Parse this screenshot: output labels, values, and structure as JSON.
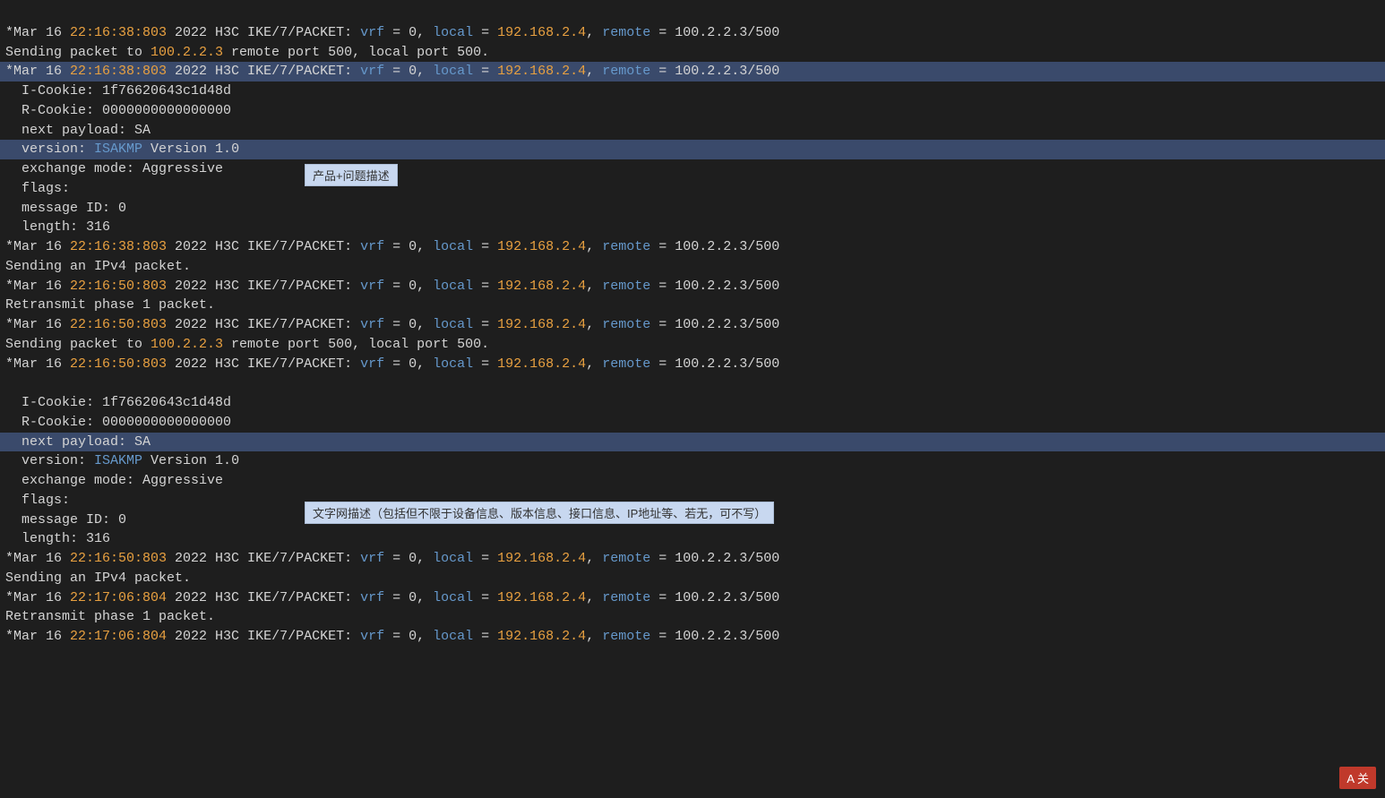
{
  "terminal": {
    "lines": [
      {
        "id": "line1",
        "type": "log",
        "prefix": "*Mar 16 ",
        "timestamp": "22:16:38:803",
        "suffix": " 2022 H3C IKE/7/PACKET: ",
        "vrf_part": "vrf",
        "rest1": " = 0, ",
        "local_label": "local",
        "rest2": " = ",
        "local_ip": "192.168.2.4",
        "rest3": ", ",
        "remote_label": "remote",
        "rest4": " = 100.2.2.3/500"
      }
    ],
    "content_blocks": [
      {
        "id": "block1",
        "lines": [
          {
            "type": "normal",
            "text": "*Mar 16 ",
            "ts": "22:16:38:803",
            "after_ts": " 2022 H3C IKE/7/PACKET: ",
            "vrf": "vrf",
            "mid": " = 0, ",
            "local_lbl": "local",
            "eq1": " = ",
            "local_ip": "192.168.2.4",
            "comma": ", ",
            "remote_lbl": "remote",
            "end": " = 100.2.2.3/500"
          },
          {
            "type": "plain",
            "text": "Sending packet to ",
            "highlight_word": "100.2.2.3",
            "plain_end": " remote port 500, local port 500."
          },
          {
            "type": "normal",
            "text": "*Mar 16 ",
            "ts": "22:16:38:803",
            "after_ts": " 2022 H3C IKE/7/PACKET: ",
            "vrf": "vrf",
            "mid": " = 0, ",
            "local_lbl": "local",
            "eq1": " = ",
            "local_ip": "192.168.2.4",
            "comma": ", ",
            "remote_lbl": "remote",
            "end": " = 100.2.2.3/500"
          }
        ]
      }
    ]
  },
  "tooltip1": {
    "text": "产品+问题描述"
  },
  "tooltip2": {
    "text": "文字网描述（包括但不限于设备信息、版本信息、接口信息、IP地址等、若无，可不写）"
  },
  "badge": {
    "text": "A 关"
  },
  "lines": [
    {
      "segments": [
        {
          "text": "*Mar 16 ",
          "color": "white"
        },
        {
          "text": "22:16:38:803",
          "color": "orange"
        },
        {
          "text": " 2022 H3C IKE/7/PACKET: ",
          "color": "white"
        },
        {
          "text": "vrf",
          "color": "blue"
        },
        {
          "text": " = 0, ",
          "color": "white"
        },
        {
          "text": "local",
          "color": "blue"
        },
        {
          "text": " = ",
          "color": "white"
        },
        {
          "text": "192.168.2.4",
          "color": "orange"
        },
        {
          "text": ", ",
          "color": "white"
        },
        {
          "text": "remote",
          "color": "blue"
        },
        {
          "text": " = 100.2.2.3/500",
          "color": "white"
        }
      ]
    },
    {
      "segments": [
        {
          "text": "Sending packet to ",
          "color": "white"
        },
        {
          "text": "100.2.2.3",
          "color": "orange"
        },
        {
          "text": " remote port 500, local port 500.",
          "color": "white"
        }
      ]
    },
    {
      "segments": [
        {
          "text": "*Mar 16 ",
          "color": "white"
        },
        {
          "text": "22:16:38:803",
          "color": "orange"
        },
        {
          "text": " 2022 H3C IKE/7/PACKET: ",
          "color": "white"
        },
        {
          "text": "vrf",
          "color": "blue"
        },
        {
          "text": " = 0, ",
          "color": "white"
        },
        {
          "text": "local",
          "color": "blue"
        },
        {
          "text": " = ",
          "color": "white"
        },
        {
          "text": "192.168.2.4",
          "color": "orange"
        },
        {
          "text": ", ",
          "color": "white"
        },
        {
          "text": "remote",
          "color": "blue"
        },
        {
          "text": " = 100.2.2.3/500",
          "color": "white"
        }
      ],
      "highlight": true
    },
    {
      "segments": [
        {
          "text": "  I-Cookie: 1f76620643c1d48d",
          "color": "white"
        }
      ]
    },
    {
      "segments": [
        {
          "text": "  R-Cookie: 0000000000000000",
          "color": "white"
        }
      ]
    },
    {
      "segments": [
        {
          "text": "  next payload: SA",
          "color": "white"
        }
      ]
    },
    {
      "segments": [
        {
          "text": "  version: ",
          "color": "white"
        },
        {
          "text": "ISAKMP",
          "color": "blue"
        },
        {
          "text": " Version 1.0",
          "color": "white"
        }
      ],
      "highlight": true,
      "tooltip": "tooltip1"
    },
    {
      "segments": [
        {
          "text": "  exchange mode: Aggressive",
          "color": "white"
        }
      ]
    },
    {
      "segments": [
        {
          "text": "  flags:",
          "color": "white"
        }
      ]
    },
    {
      "segments": [
        {
          "text": "  message ID: 0",
          "color": "white"
        }
      ]
    },
    {
      "segments": [
        {
          "text": "  length: 316",
          "color": "white"
        }
      ]
    },
    {
      "segments": [
        {
          "text": "*Mar 16 ",
          "color": "white"
        },
        {
          "text": "22:16:38:803",
          "color": "orange"
        },
        {
          "text": " 2022 H3C IKE/7/PACKET: ",
          "color": "white"
        },
        {
          "text": "vrf",
          "color": "blue"
        },
        {
          "text": " = 0, ",
          "color": "white"
        },
        {
          "text": "local",
          "color": "blue"
        },
        {
          "text": " = ",
          "color": "white"
        },
        {
          "text": "192.168.2.4",
          "color": "orange"
        },
        {
          "text": ", ",
          "color": "white"
        },
        {
          "text": "remote",
          "color": "blue"
        },
        {
          "text": " = 100.2.2.3/500",
          "color": "white"
        }
      ]
    },
    {
      "segments": [
        {
          "text": "Sending an IPv4 packet.",
          "color": "white"
        }
      ]
    },
    {
      "segments": [
        {
          "text": "*Mar 16 ",
          "color": "white"
        },
        {
          "text": "22:16:50:803",
          "color": "orange"
        },
        {
          "text": " 2022 H3C IKE/7/PACKET: ",
          "color": "white"
        },
        {
          "text": "vrf",
          "color": "blue"
        },
        {
          "text": " = 0, ",
          "color": "white"
        },
        {
          "text": "local",
          "color": "blue"
        },
        {
          "text": " = ",
          "color": "white"
        },
        {
          "text": "192.168.2.4",
          "color": "orange"
        },
        {
          "text": ", ",
          "color": "white"
        },
        {
          "text": "remote",
          "color": "blue"
        },
        {
          "text": " = 100.2.2.3/500",
          "color": "white"
        }
      ]
    },
    {
      "segments": [
        {
          "text": "Retransmit phase 1 packet.",
          "color": "white"
        }
      ]
    },
    {
      "segments": [
        {
          "text": "*Mar 16 ",
          "color": "white"
        },
        {
          "text": "22:16:50:803",
          "color": "orange"
        },
        {
          "text": " 2022 H3C IKE/7/PACKET: ",
          "color": "white"
        },
        {
          "text": "vrf",
          "color": "blue"
        },
        {
          "text": " = 0, ",
          "color": "white"
        },
        {
          "text": "local",
          "color": "blue"
        },
        {
          "text": " = ",
          "color": "white"
        },
        {
          "text": "192.168.2.4",
          "color": "orange"
        },
        {
          "text": ", ",
          "color": "white"
        },
        {
          "text": "remote",
          "color": "blue"
        },
        {
          "text": " = 100.2.2.3/500",
          "color": "white"
        }
      ]
    },
    {
      "segments": [
        {
          "text": "Sending packet to ",
          "color": "white"
        },
        {
          "text": "100.2.2.3",
          "color": "orange"
        },
        {
          "text": " remote port 500, local port 500.",
          "color": "white"
        }
      ]
    },
    {
      "segments": [
        {
          "text": "*Mar 16 ",
          "color": "white"
        },
        {
          "text": "22:16:50:803",
          "color": "orange"
        },
        {
          "text": " 2022 H3C IKE/7/PACKET: ",
          "color": "white"
        },
        {
          "text": "vrf",
          "color": "blue"
        },
        {
          "text": " = 0, ",
          "color": "white"
        },
        {
          "text": "local",
          "color": "blue"
        },
        {
          "text": " = ",
          "color": "white"
        },
        {
          "text": "192.168.2.4",
          "color": "orange"
        },
        {
          "text": ", ",
          "color": "white"
        },
        {
          "text": "remote",
          "color": "blue"
        },
        {
          "text": " = 100.2.2.3/500",
          "color": "white"
        }
      ]
    },
    {
      "segments": [
        {
          "text": "",
          "color": "white"
        }
      ]
    },
    {
      "segments": [
        {
          "text": "  I-Cookie: 1f76620643c1d48d",
          "color": "white"
        }
      ]
    },
    {
      "segments": [
        {
          "text": "  R-Cookie: 0000000000000000",
          "color": "white"
        }
      ]
    },
    {
      "segments": [
        {
          "text": "  next payload: SA",
          "color": "white"
        }
      ],
      "highlight": true,
      "tooltip": "tooltip2"
    },
    {
      "segments": [
        {
          "text": "  version: ",
          "color": "white"
        },
        {
          "text": "ISAKMP",
          "color": "blue"
        },
        {
          "text": " Version 1.0",
          "color": "white"
        }
      ]
    },
    {
      "segments": [
        {
          "text": "  exchange mode: Aggressive",
          "color": "white"
        }
      ]
    },
    {
      "segments": [
        {
          "text": "  flags:",
          "color": "white"
        }
      ]
    },
    {
      "segments": [
        {
          "text": "  message ID: 0",
          "color": "white"
        }
      ]
    },
    {
      "segments": [
        {
          "text": "  length: 316",
          "color": "white"
        }
      ]
    },
    {
      "segments": [
        {
          "text": "*Mar 16 ",
          "color": "white"
        },
        {
          "text": "22:16:50:803",
          "color": "orange"
        },
        {
          "text": " 2022 H3C IKE/7/PACKET: ",
          "color": "white"
        },
        {
          "text": "vrf",
          "color": "blue"
        },
        {
          "text": " = 0, ",
          "color": "white"
        },
        {
          "text": "local",
          "color": "blue"
        },
        {
          "text": " = ",
          "color": "white"
        },
        {
          "text": "192.168.2.4",
          "color": "orange"
        },
        {
          "text": ", ",
          "color": "white"
        },
        {
          "text": "remote",
          "color": "blue"
        },
        {
          "text": " = 100.2.2.3/",
          "color": "white"
        },
        {
          "text": "500",
          "color": "white"
        }
      ]
    },
    {
      "segments": [
        {
          "text": "Sending an IPv4 packet.",
          "color": "white"
        }
      ]
    },
    {
      "segments": [
        {
          "text": "*Mar 16 ",
          "color": "white"
        },
        {
          "text": "22:17:06:804",
          "color": "orange"
        },
        {
          "text": " 2022 H3C IKE/7/PACKET: ",
          "color": "white"
        },
        {
          "text": "vrf",
          "color": "blue"
        },
        {
          "text": " = 0, ",
          "color": "white"
        },
        {
          "text": "local",
          "color": "blue"
        },
        {
          "text": " = ",
          "color": "white"
        },
        {
          "text": "192.168.2.4",
          "color": "orange"
        },
        {
          "text": ", ",
          "color": "white"
        },
        {
          "text": "remote",
          "color": "blue"
        },
        {
          "text": " = 100.2.2.3/500",
          "color": "white"
        }
      ]
    },
    {
      "segments": [
        {
          "text": "Retransmit phase 1 packet.",
          "color": "white"
        }
      ]
    },
    {
      "segments": [
        {
          "text": "*Mar 16 ",
          "color": "white"
        },
        {
          "text": "22:17:06:804",
          "color": "orange"
        },
        {
          "text": " 2022 H3C IKE/7/PACKET: ",
          "color": "white"
        },
        {
          "text": "vrf",
          "color": "blue"
        },
        {
          "text": " = 0, ",
          "color": "white"
        },
        {
          "text": "local",
          "color": "blue"
        },
        {
          "text": " = ",
          "color": "white"
        },
        {
          "text": "192.168.2.4",
          "color": "orange"
        },
        {
          "text": ", ",
          "color": "white"
        },
        {
          "text": "remote",
          "color": "blue"
        },
        {
          "text": " = 100.2.2.3/500",
          "color": "white"
        }
      ]
    }
  ]
}
